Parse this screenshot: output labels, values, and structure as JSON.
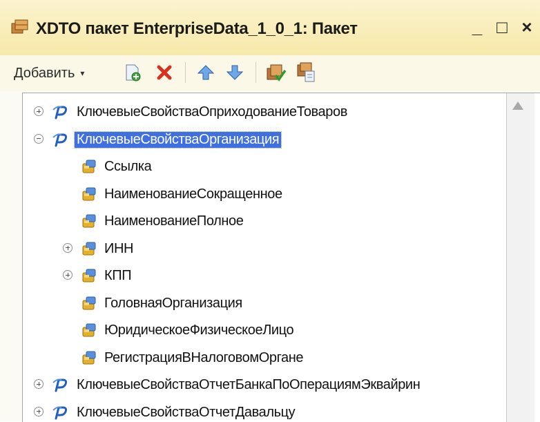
{
  "window": {
    "title": "XDTO пакет EnterpriseData_1_0_1: Пакет",
    "title_icon": "package-icon",
    "buttons": {
      "minimize": "_",
      "maximize": "□",
      "close": "×"
    }
  },
  "toolbar": {
    "add_label": "Добавить",
    "add_caret": "▾",
    "icons": [
      "add-item-icon",
      "delete-icon",
      "move-up-icon",
      "move-down-icon",
      "check-package-icon",
      "import-package-icon"
    ]
  },
  "tree": {
    "rows": [
      {
        "label": "КлючевыеСвойстваОприходованиеТоваров",
        "kind": "type",
        "expander": "plus",
        "level": 0
      },
      {
        "label": "КлючевыеСвойстваОрганизация",
        "kind": "type",
        "expander": "minus",
        "level": 0,
        "selected": true
      },
      {
        "label": "Ссылка",
        "kind": "property",
        "expander": "none",
        "level": 1
      },
      {
        "label": "НаименованиеСокращенное",
        "kind": "property",
        "expander": "none",
        "level": 1
      },
      {
        "label": "НаименованиеПолное",
        "kind": "property",
        "expander": "none",
        "level": 1
      },
      {
        "label": "ИНН",
        "kind": "property",
        "expander": "plus",
        "level": 1
      },
      {
        "label": "КПП",
        "kind": "property",
        "expander": "plus",
        "level": 1
      },
      {
        "label": "ГоловнаяОрганизация",
        "kind": "property",
        "expander": "none",
        "level": 1
      },
      {
        "label": "ЮридическоеФизическоеЛицо",
        "kind": "property",
        "expander": "none",
        "level": 1
      },
      {
        "label": "РегистрацияВНалоговомОргане",
        "kind": "property",
        "expander": "none",
        "level": 1
      },
      {
        "label": "КлючевыеСвойстваОтчетБанкаПоОперациямЭквайрин",
        "kind": "type",
        "expander": "plus",
        "level": 0
      },
      {
        "label": "КлючевыеСвойстваОтчетДавальцу",
        "kind": "type",
        "expander": "plus",
        "level": 0
      }
    ]
  },
  "colors": {
    "titlebar": "#f7e9a8",
    "selection": "#3f6fe0",
    "type_icon": "#1f5fbf",
    "property_icon": "#e5b02a"
  }
}
